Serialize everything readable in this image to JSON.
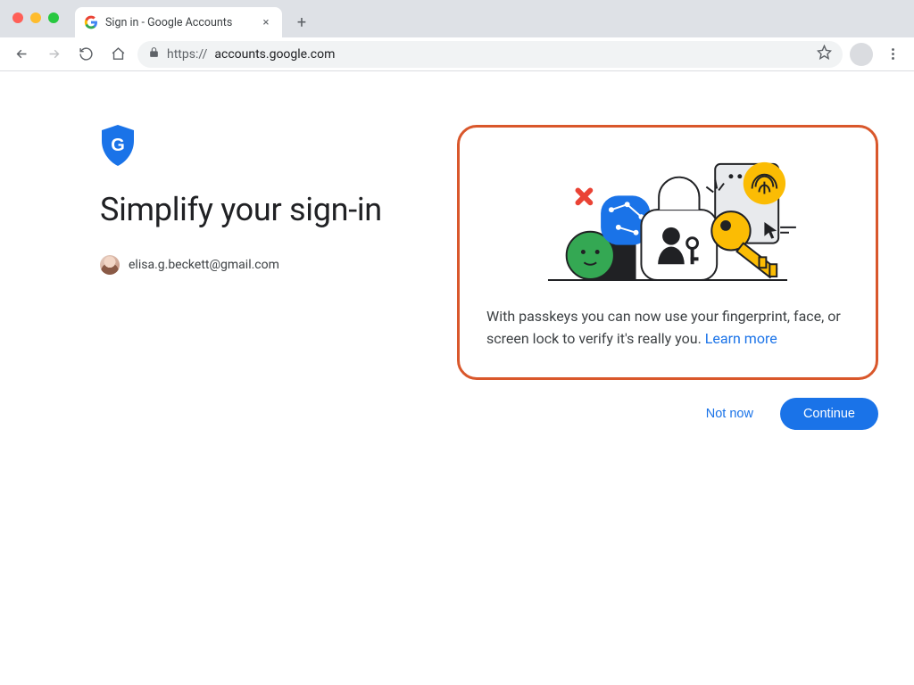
{
  "browser": {
    "tab_title": "Sign in - Google Accounts",
    "url_scheme": "https://",
    "url_host": "accounts.google.com",
    "new_tab_glyph": "+",
    "close_glyph": "×"
  },
  "page": {
    "title": "Simplify your sign-in",
    "account_email": "elisa.g.beckett@gmail.com"
  },
  "callout": {
    "body_text": "With passkeys you can now use your fingerprint, face, or screen lock to verify it's really you. ",
    "learn_more_label": "Learn more"
  },
  "actions": {
    "not_now_label": "Not now",
    "continue_label": "Continue"
  },
  "icons": {
    "shield": "shield-g-icon",
    "favicon": "google-g-icon"
  },
  "colors": {
    "accent_blue": "#1a73e8",
    "callout_border": "#d9572b"
  }
}
